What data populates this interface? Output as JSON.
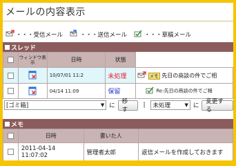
{
  "page": {
    "title": "メールの内容表示"
  },
  "legend": {
    "received": "・・・受信メール",
    "sent": "・・・送信メール",
    "draft": "・・・草稿メール"
  },
  "thread": {
    "section_label": "スレッド",
    "headers": {
      "window_display": "ウィンドウ表示",
      "datetime": "日時",
      "status": "状態"
    },
    "rows": [
      {
        "datetime": "10/07/01 11:2",
        "status": "未処理",
        "memo_label": "メモ",
        "subject": "先日の商談の件でご相"
      },
      {
        "datetime": "04/14 11:09",
        "status": "保留",
        "subject": "Re:先日の商談の件でご相"
      }
    ]
  },
  "actions": {
    "folder_select": "[ゴミ箱]",
    "ni1": "に",
    "move_button": "移す",
    "separator": "|",
    "status_select": "未処理",
    "ni2": "に",
    "change_button": "変更する"
  },
  "memo": {
    "section_label": "メモ",
    "headers": {
      "datetime": "日時",
      "author": "書いた人"
    },
    "rows": [
      {
        "date": "2011-04-14",
        "time": "11:07:02",
        "author": "管理者太郎",
        "content": "返信メールを作成しておきます"
      }
    ]
  },
  "colors": {
    "frame": "#f6c400",
    "section_bar": "#8c5c5c",
    "header_bg": "#c9b3b3",
    "highlight_row": "#dff6fb",
    "status_unprocessed": "#e8202a",
    "status_hold": "#2233cc"
  }
}
